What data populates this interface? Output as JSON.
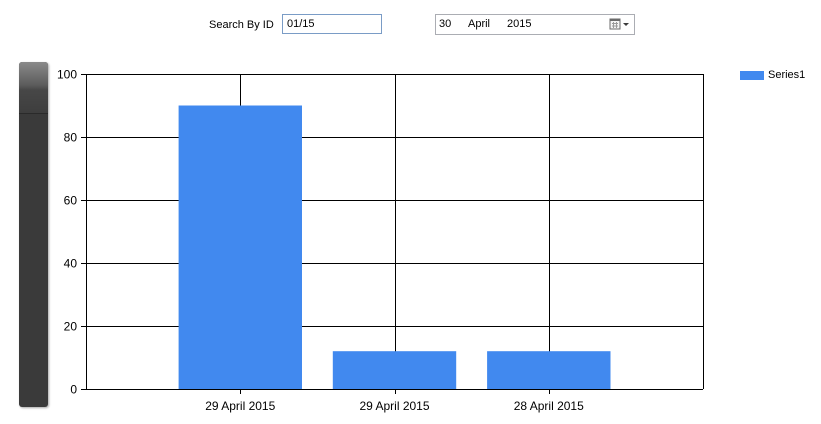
{
  "search": {
    "label": "Search By ID",
    "value": "01/15"
  },
  "date_picker": {
    "day": "30",
    "month": "April",
    "year": "2015",
    "icon": "calendar-dropdown-icon"
  },
  "colors": {
    "bar": "#4189ef",
    "gridline": "#000000",
    "scroll_panel": "#3a3a3a"
  },
  "legend": {
    "position": "top-right",
    "items": [
      {
        "name": "Series1"
      }
    ]
  },
  "chart_data": {
    "type": "bar",
    "categories": [
      "29 April 2015",
      "29 April 2015",
      "28 April 2015"
    ],
    "series": [
      {
        "name": "Series1",
        "values": [
          90,
          12,
          12
        ]
      }
    ],
    "ylim": [
      0,
      100
    ],
    "yticks": [
      0,
      20,
      40,
      60,
      80,
      100
    ],
    "grid": true,
    "legend_position": "top-right"
  }
}
